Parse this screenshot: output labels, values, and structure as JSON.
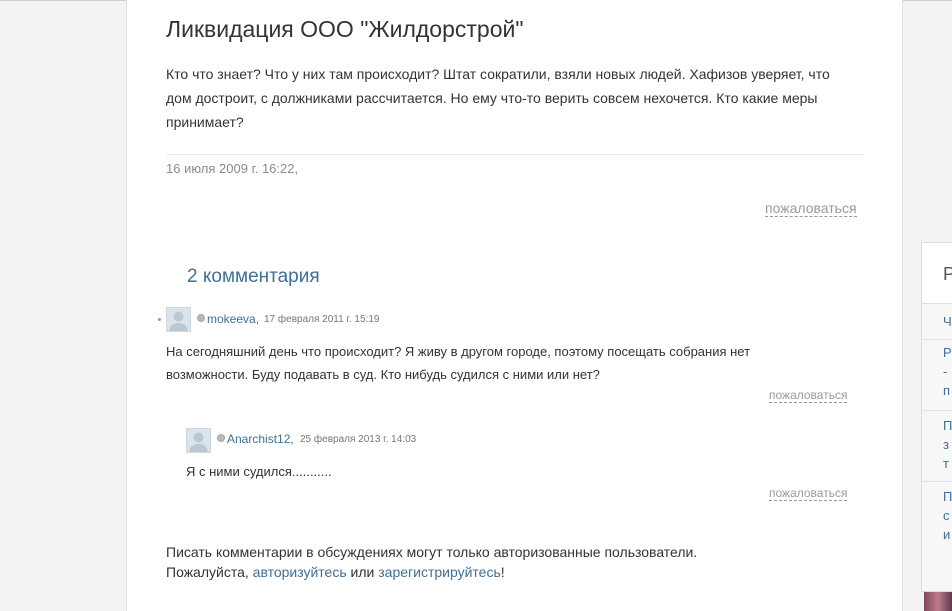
{
  "post": {
    "title": "Ликвидация ООО \"Жилдорстрой\"",
    "body_lines": [
      "Кто что знает? Что у них там происходит? Штат сократили, взяли новых людей. Хафизов уверяет, что",
      "дом достроит, с должниками рассчитается. Но ему что-то верить совсем нехочется. Кто какие меры",
      "принимает?"
    ],
    "date": "16 июля 2009 г. 16:22,",
    "report_label": "пожаловаться"
  },
  "comments": {
    "heading": "2 комментария",
    "items": [
      {
        "author": "mokeeva,",
        "date": "17 февраля 2011 г. 15:19",
        "text_lines": [
          "На сегодняшний день что происходит? Я живу в другом городе, поэтому посещать собрания нет",
          "возможности. Буду подавать в суд. Кто нибудь судился с ними или нет?"
        ],
        "report_label": "пожаловаться"
      },
      {
        "author": "Anarchist12,",
        "date": "25 февраля 2013 г. 14:03",
        "text_lines": [
          "Я с ними судился..........."
        ],
        "report_label": "пожаловаться"
      }
    ]
  },
  "footer": {
    "line1": "Писать комментарии в обсуждениях могут только авторизованные пользователи.",
    "line2_prefix": "Пожалуйста, ",
    "login_link": "авторизуйтесь",
    "middle": " или ",
    "register_link": "зарегистрируйтесь",
    "suffix": "!"
  },
  "sidebar": {
    "head": "Р",
    "items": [
      {
        "text": "Ч"
      },
      {
        "text": "Р\n-\nп"
      },
      {
        "text": "П\nз\nт"
      },
      {
        "text": "П\nс\nи"
      }
    ]
  },
  "colors": {
    "link": "#3f6f96",
    "text": "#333333",
    "muted": "#8a8a8a",
    "background": "#f3f3f3"
  }
}
